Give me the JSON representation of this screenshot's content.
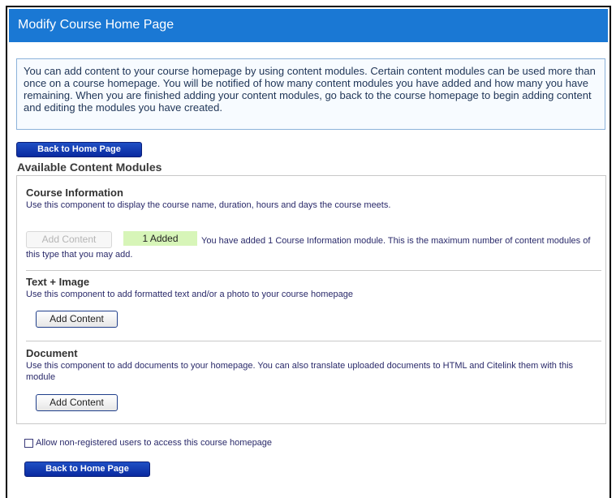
{
  "page": {
    "title": "Modify Course Home Page",
    "intro": "You can add content to your course homepage by using content modules. Certain content modules can be used more than once on a course homepage. You will be notified of how many content modules you have added and how many you have remaining. When you are finished adding your content modules, go back to the course homepage to begin adding content and editing the modules you have created.",
    "back_button_label": "Back to Home Page",
    "section_title": "Available Content Modules"
  },
  "modules": [
    {
      "title": "Course Information",
      "description": "Use this component to display the course name, duration, hours and days the course meets.",
      "button_label": "Add Content",
      "button_disabled": true,
      "added_label": "1 Added",
      "added_message": "You have added 1 Course Information module. This is the maximum number of content modules of this type that you may add."
    },
    {
      "title": "Text + Image",
      "description": "Use this component to add formatted text and/or a photo to your course homepage",
      "button_label": "Add Content"
    },
    {
      "title": "Document",
      "description": "Use this component to add documents to your homepage. You can also translate uploaded documents to HTML and Citelink them with this module",
      "button_label": "Add Content"
    }
  ],
  "options": {
    "allow_non_registered_label": "Allow non-registered users to access this course homepage",
    "allow_non_registered_checked": false
  },
  "colors": {
    "header_bg": "#1a78d4",
    "added_badge_bg": "#d7f5b8",
    "primary_button": "#0a2aa0"
  }
}
